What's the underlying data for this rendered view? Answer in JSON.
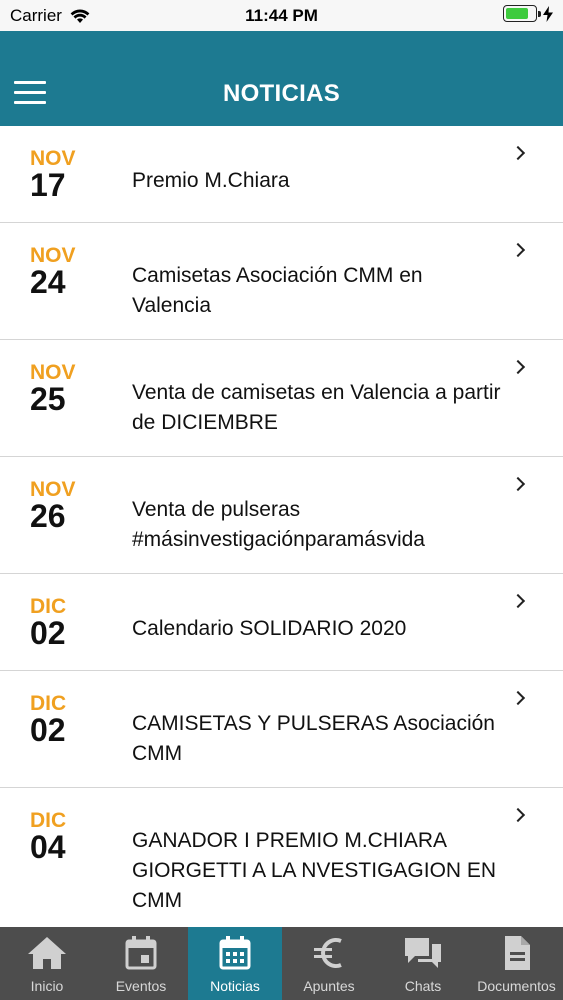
{
  "status_bar": {
    "carrier": "Carrier",
    "time": "11:44 PM",
    "battery_level": 0.8,
    "battery_color": "#3ecb3e"
  },
  "header": {
    "title": "NOTICIAS",
    "background_color": "#1d7a91"
  },
  "colors": {
    "month": "#f0a020",
    "tab_bar": "#4d4d4d",
    "tab_active": "#1d7a91"
  },
  "news": [
    {
      "month": "NOV",
      "day": "17",
      "title": "Premio M.Chiara"
    },
    {
      "month": "NOV",
      "day": "24",
      "title": "Camisetas Asociación CMM en Valencia"
    },
    {
      "month": "NOV",
      "day": "25",
      "title": "Venta de camisetas en Valencia a partir de DICIEMBRE"
    },
    {
      "month": "NOV",
      "day": "26",
      "title": "Venta de pulseras #másinvestigaciónparamásvida"
    },
    {
      "month": "DIC",
      "day": "02",
      "title": "Calendario SOLIDARIO 2020"
    },
    {
      "month": "DIC",
      "day": "02",
      "title": "CAMISETAS Y PULSERAS Asociación CMM"
    },
    {
      "month": "DIC",
      "day": "04",
      "title": "GANADOR I PREMIO M.CHIARA GIORGETTI A LA NVESTIGAGION EN CMM"
    }
  ],
  "tabs": [
    {
      "label": "Inicio",
      "icon": "home-icon"
    },
    {
      "label": "Eventos",
      "icon": "calendar-day-icon"
    },
    {
      "label": "Noticias",
      "icon": "calendar-grid-icon",
      "active": true
    },
    {
      "label": "Apuntes",
      "icon": "euro-icon"
    },
    {
      "label": "Chats",
      "icon": "chat-bubbles-icon"
    },
    {
      "label": "Documentos",
      "icon": "document-icon"
    }
  ]
}
